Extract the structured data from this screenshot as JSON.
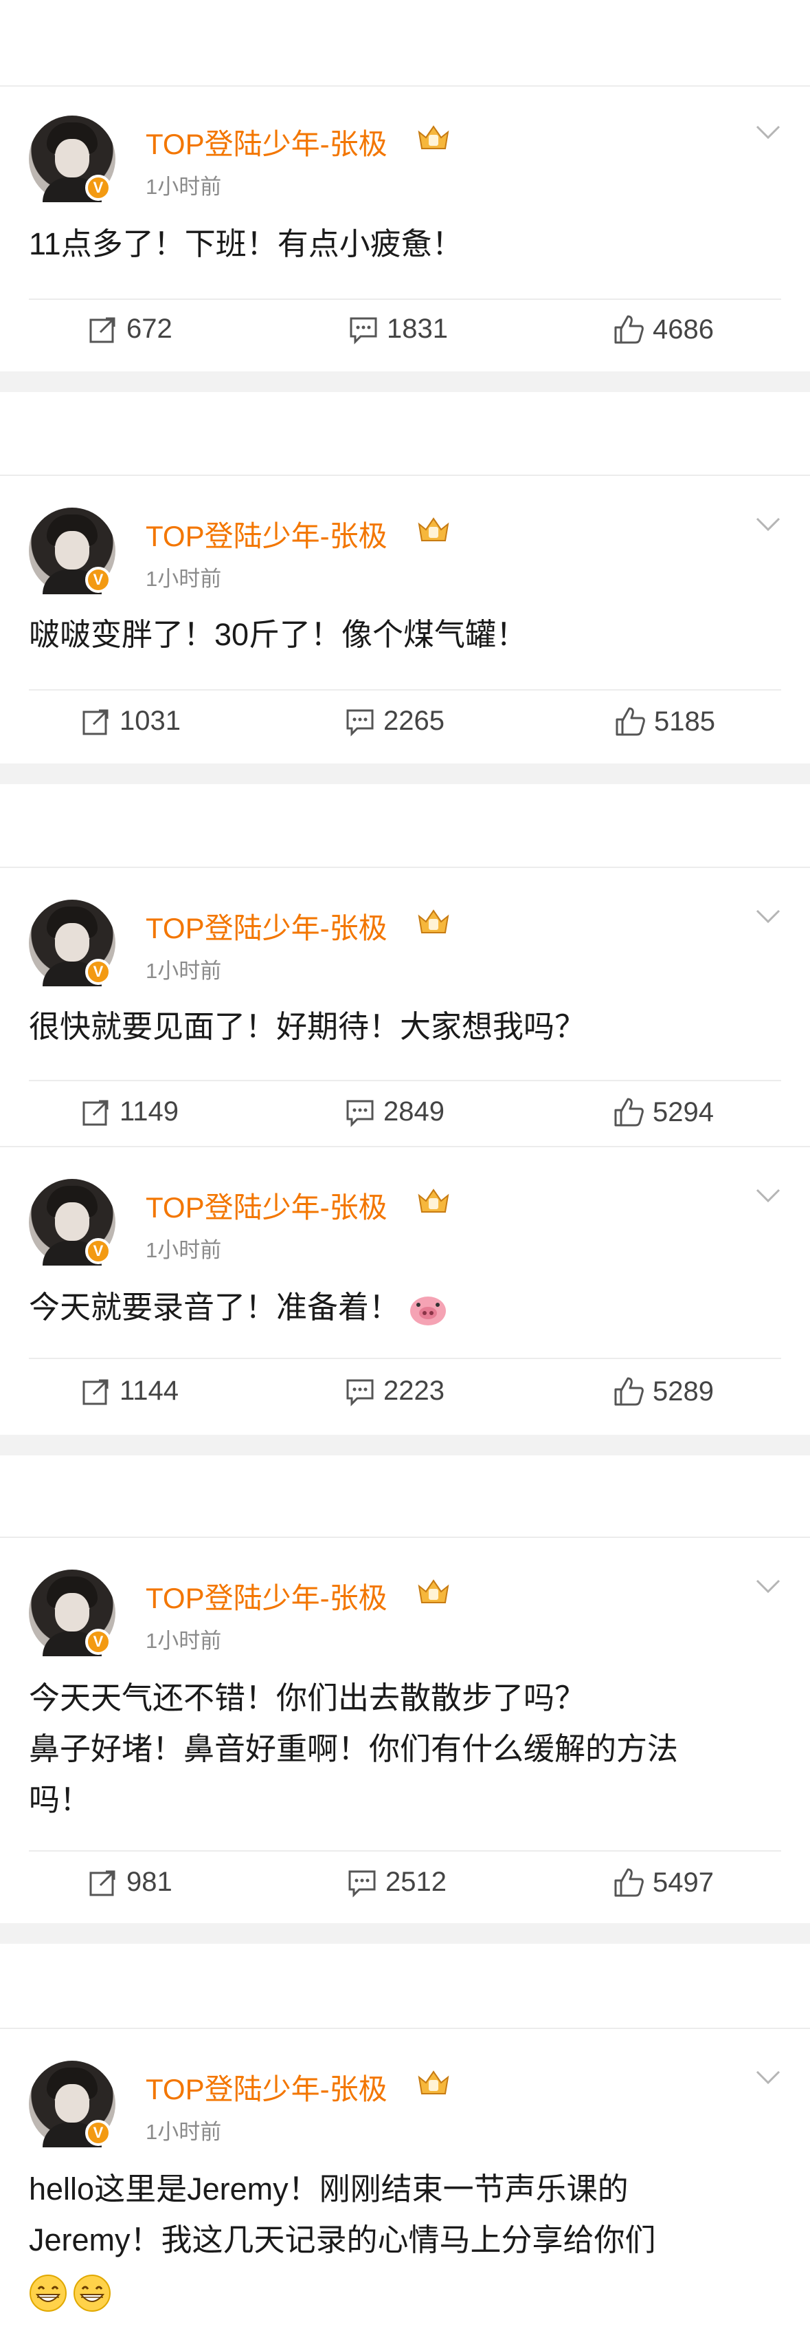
{
  "colors": {
    "name": "#f37600",
    "badge": "#f39a12",
    "gap": "#f2f2f2",
    "divider": "#ececec",
    "meta": "#8a8a8a"
  },
  "icons": {
    "repost": "repost-icon",
    "comment": "comment-icon",
    "like": "like-icon",
    "more": "chevron-down-icon",
    "verified": "verified-v-icon",
    "crown": "crown-member-icon"
  },
  "verified_label": "V",
  "posts": [
    {
      "author": "TOP登陆少年-张极",
      "time": "1小时前",
      "text": "11点多了！下班！有点小疲惫！",
      "reposts": "672",
      "comments": "1831",
      "likes": "4686"
    },
    {
      "author": "TOP登陆少年-张极",
      "time": "1小时前",
      "text": "啵啵变胖了！30斤了！像个煤气罐！",
      "reposts": "1031",
      "comments": "2265",
      "likes": "5185"
    },
    {
      "author": "TOP登陆少年-张极",
      "time": "1小时前",
      "text": "很快就要见面了！好期待！大家想我吗？",
      "reposts": "1149",
      "comments": "2849",
      "likes": "5294"
    },
    {
      "author": "TOP登陆少年-张极",
      "time": "1小时前",
      "text": "今天就要录音了！准备着！",
      "emoji": "pig-face-emoji",
      "reposts": "1144",
      "comments": "2223",
      "likes": "5289"
    },
    {
      "author": "TOP登陆少年-张极",
      "time": "1小时前",
      "text_lines": [
        "今天天气还不错！你们出去散散步了吗？",
        "鼻子好堵！鼻音好重啊！你们有什么缓解的方法",
        "吗！"
      ],
      "reposts": "981",
      "comments": "2512",
      "likes": "5497"
    },
    {
      "author": "TOP登陆少年-张极",
      "time": "1小时前",
      "text_lines": [
        "hello这里是Jeremy！刚刚结束一节声乐课的",
        "Jeremy！我这几天记录的心情马上分享给你们"
      ],
      "emoji": "grinning-face-emoji"
    }
  ]
}
